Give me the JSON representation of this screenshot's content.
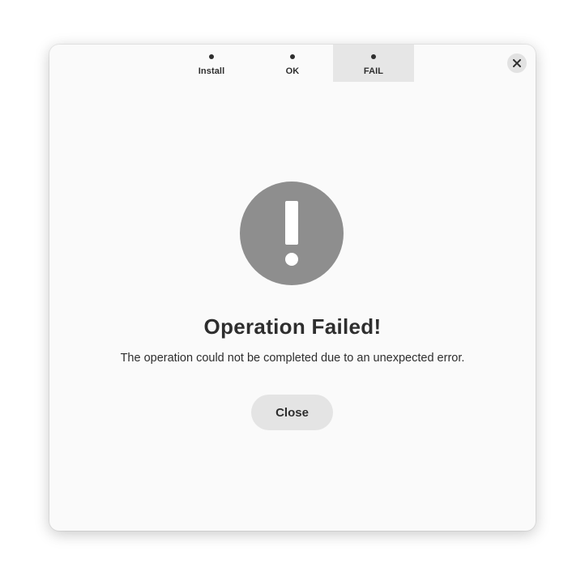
{
  "tabs": [
    {
      "label": "Install",
      "active": false
    },
    {
      "label": "OK",
      "active": false
    },
    {
      "label": "FAIL",
      "active": true
    }
  ],
  "dialog": {
    "title": "Operation Failed!",
    "message": "The operation could not be completed due to an unexpected error.",
    "button_label": "Close",
    "icon": "exclamation-circle-icon",
    "close_icon": "close-icon"
  },
  "colors": {
    "window_bg": "#fafafa",
    "icon_circle": "#8e8e8e",
    "text": "#2e2e2e",
    "button_bg": "#e4e4e4",
    "active_tab_bg": "#e6e6e6"
  }
}
